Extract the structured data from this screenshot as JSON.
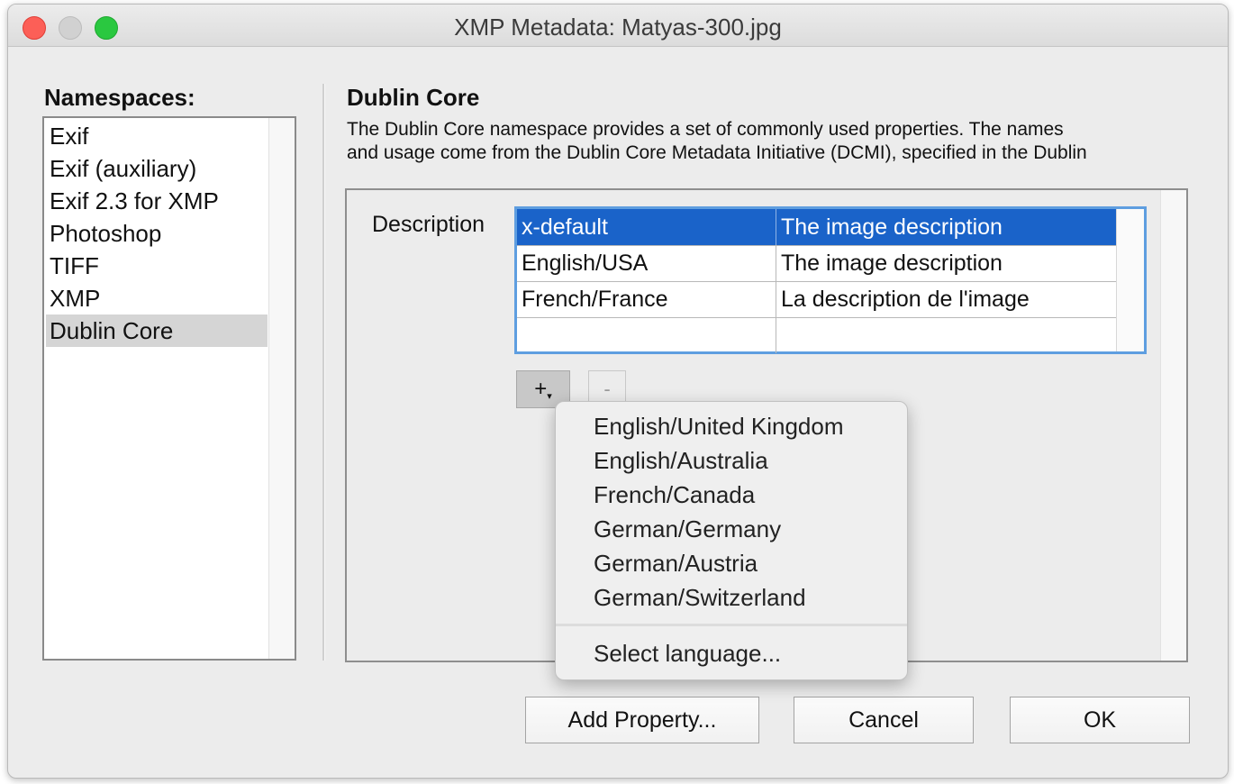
{
  "window": {
    "title": "XMP Metadata: Matyas-300.jpg"
  },
  "namespaces": {
    "heading": "Namespaces:",
    "items": [
      "Exif",
      "Exif (auxiliary)",
      "Exif 2.3 for XMP",
      "Photoshop",
      "TIFF",
      "XMP",
      "Dublin Core"
    ],
    "selected": "Dublin Core"
  },
  "section": {
    "title": "Dublin Core",
    "description_line1": "The Dublin Core namespace provides a set of commonly used properties. The names",
    "description_line2": "and usage come from the Dublin Core Metadata Initiative (DCMI), specified in the Dublin"
  },
  "property": {
    "label": "Description",
    "rows": [
      {
        "language": "x-default",
        "value": "The image description"
      },
      {
        "language": "English/USA",
        "value": "The image description"
      },
      {
        "language": "French/France",
        "value": "La description de l'image"
      },
      {
        "language": "",
        "value": ""
      }
    ]
  },
  "controls": {
    "add": "+",
    "add_arrow": "▾",
    "remove": "-"
  },
  "language_menu": {
    "items": [
      "English/United Kingdom",
      "English/Australia",
      "French/Canada",
      "German/Germany",
      "German/Austria",
      "German/Switzerland"
    ],
    "select_language": "Select language..."
  },
  "buttons": {
    "add_property": "Add Property...",
    "cancel": "Cancel",
    "ok": "OK"
  },
  "colors": {
    "selection": "#1a63c9",
    "table_focus": "#5e9ee0",
    "close": "#fc5f57",
    "maximize": "#2ac840"
  }
}
